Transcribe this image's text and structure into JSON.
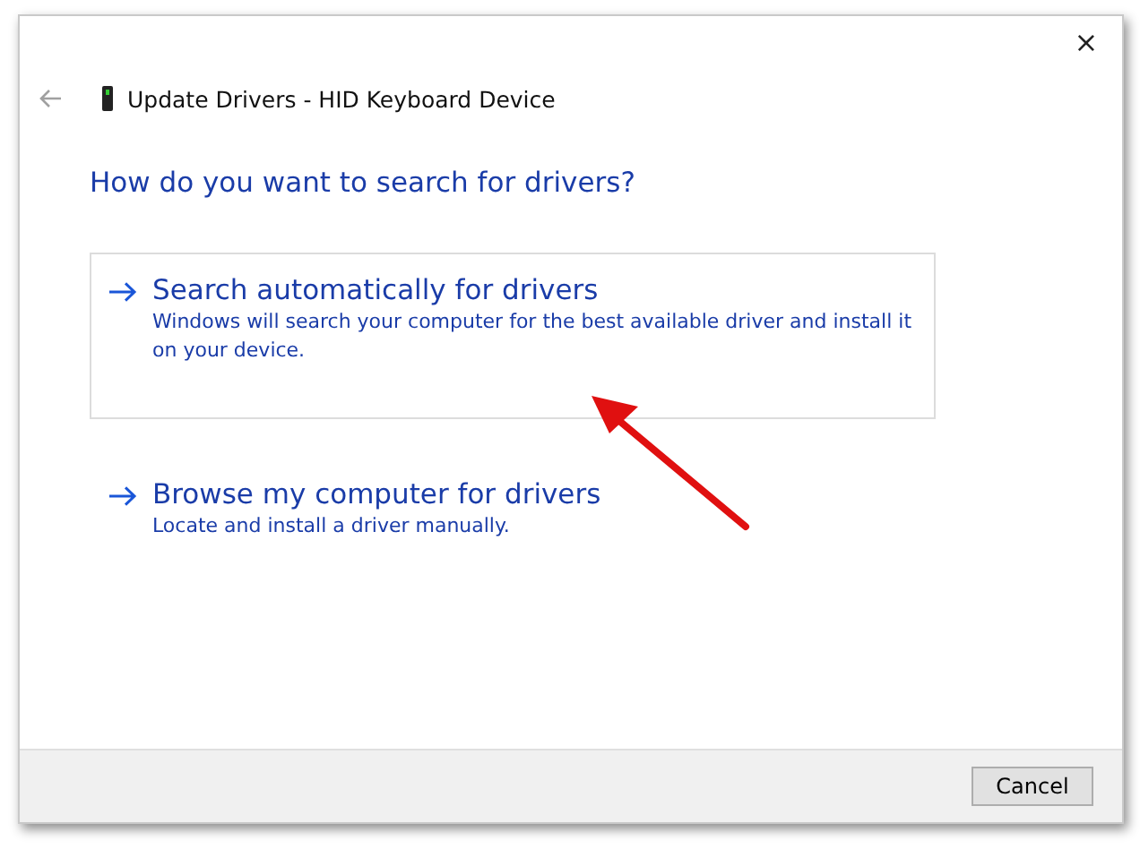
{
  "window": {
    "title": "Update Drivers - HID Keyboard Device",
    "close": "×"
  },
  "heading": "How do you want to search for drivers?",
  "options": [
    {
      "title": "Search automatically for drivers",
      "description": "Windows will search your computer for the best available driver and install it on your device.",
      "highlighted": true
    },
    {
      "title": "Browse my computer for drivers",
      "description": "Locate and install a driver manually.",
      "highlighted": false
    }
  ],
  "buttons": [
    "Cancel"
  ]
}
